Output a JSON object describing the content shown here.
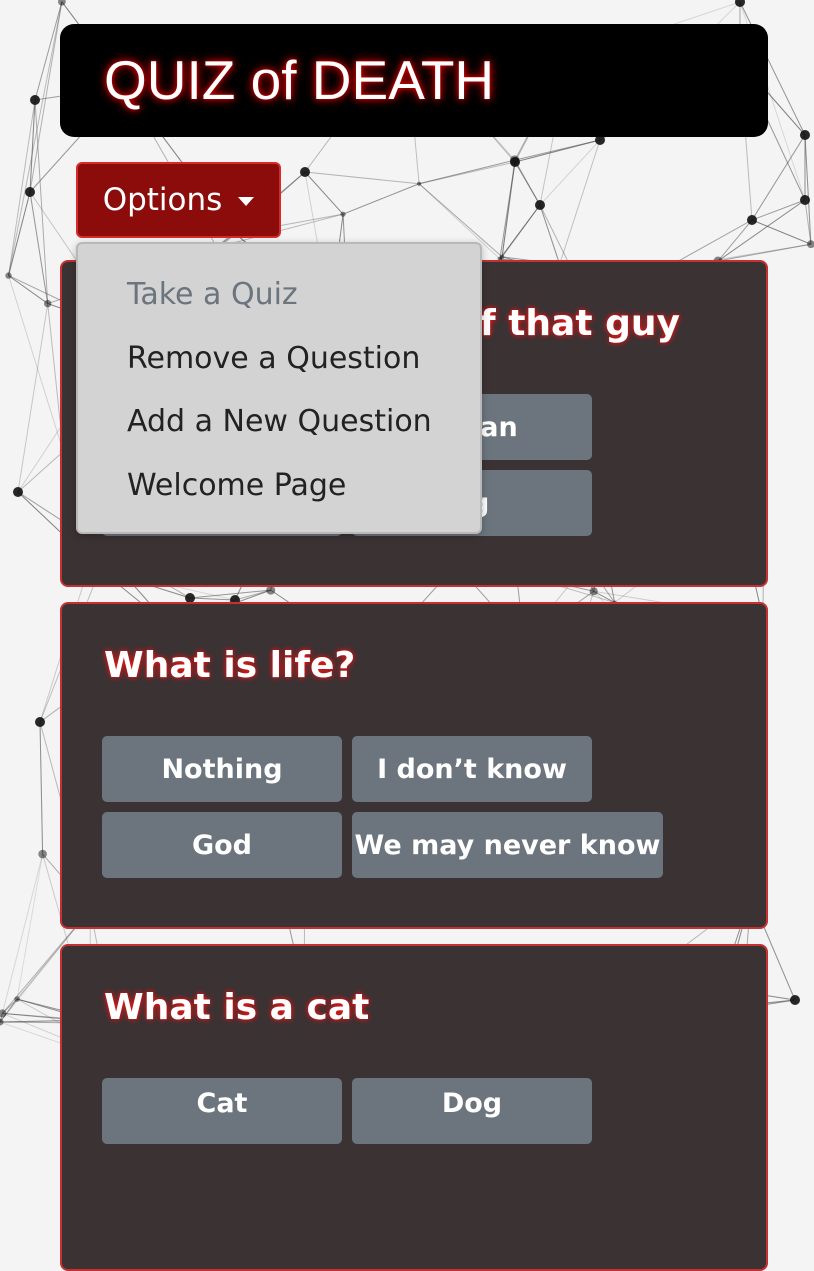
{
  "header": {
    "title": "QUIZ of DEATH"
  },
  "options_button": {
    "label": "Options"
  },
  "menu": {
    "items": [
      {
        "label": "Take a Quiz",
        "disabled": true
      },
      {
        "label": "Remove a Question",
        "disabled": false
      },
      {
        "label": "Add a New Question",
        "disabled": false
      },
      {
        "label": "Welcome Page",
        "disabled": false
      }
    ]
  },
  "cards": [
    {
      "question": "f that guy",
      "answers": [
        "ean",
        "g"
      ]
    },
    {
      "question": "What is life?",
      "answers": [
        "Nothing",
        "I don’t know",
        "God",
        "We may never know"
      ]
    },
    {
      "question": "What is a cat",
      "answers": [
        "Cat",
        "Dog"
      ]
    }
  ],
  "colors": {
    "header_bg": "#000000",
    "accent_red": "#8c0b0b",
    "card_bg": "#3b3234",
    "card_border": "#c53030",
    "answer_bg": "#6c757d",
    "menu_bg": "#d3d3d3"
  },
  "icons": {
    "options_caret": "caret-down-icon"
  }
}
